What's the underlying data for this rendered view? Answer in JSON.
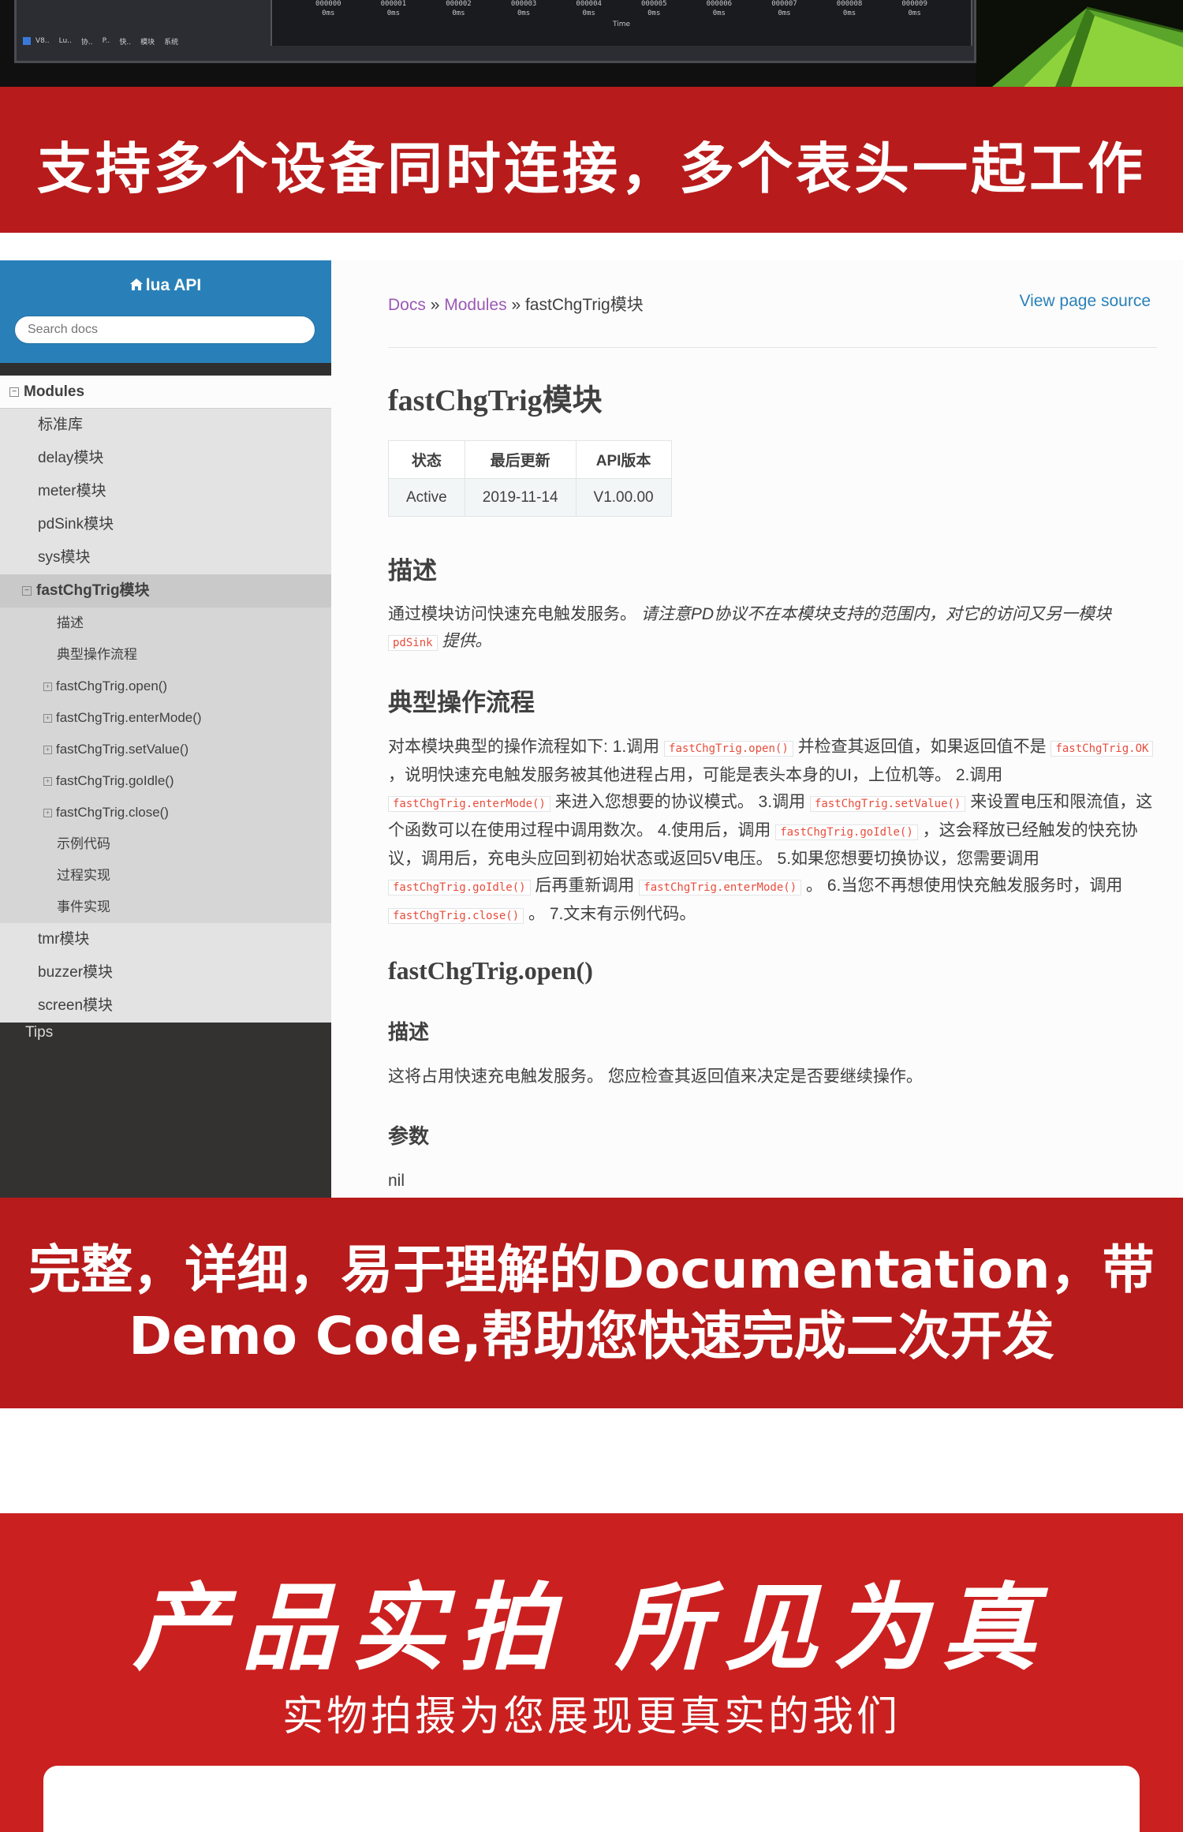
{
  "top_strip": {
    "tick_ids": [
      "000000",
      "000001",
      "000002",
      "000003",
      "000004",
      "000005",
      "000006",
      "000007",
      "000008",
      "000009"
    ],
    "tick_ms": [
      "0ms",
      "0ms",
      "0ms",
      "0ms",
      "0ms",
      "0ms",
      "0ms",
      "0ms",
      "0ms",
      "0ms"
    ],
    "time_label": "Time",
    "taskbar_items": [
      "V8..",
      "Lu..",
      "协..",
      "P..",
      "快..",
      "模块",
      "系统"
    ]
  },
  "banner1": {
    "text": "支持多个设备同时连接，多个表头一起工作"
  },
  "nav": {
    "home_label": "lua API",
    "search_placeholder": "Search docs",
    "modules_label": "Modules",
    "items": [
      "标准库",
      "delay模块",
      "meter模块",
      "pdSink模块",
      "sys模块"
    ],
    "active_item": "fastChgTrig模块",
    "sub_items": [
      "描述",
      "典型操作流程",
      "fastChgTrig.open()",
      "fastChgTrig.enterMode()",
      "fastChgTrig.setValue()",
      "fastChgTrig.goIdle()",
      "fastChgTrig.close()",
      "示例代码",
      "过程实现",
      "事件实现"
    ],
    "after_items": [
      "tmr模块",
      "buzzer模块",
      "screen模块"
    ],
    "tips_label": "Tips"
  },
  "content": {
    "breadcrumb": {
      "docs": "Docs",
      "sep1": " » ",
      "modules": "Modules",
      "sep2": " » ",
      "current": "fastChgTrig模块"
    },
    "view_source": "View page source",
    "title": "fastChgTrig模块",
    "table": {
      "headers": [
        "状态",
        "最后更新",
        "API版本"
      ],
      "row": [
        "Active",
        "2019-11-14",
        "V1.00.00"
      ]
    },
    "desc_heading": "描述",
    "desc_text": "通过模块访问快速充电触发服务。",
    "desc_note": "请注意PD协议不在本模块支持的范围内，对它的访问又另一模块",
    "desc_code": "pdSink",
    "desc_note_end": "提供。",
    "flow_heading": "典型操作流程",
    "flow": {
      "t1": "对本模块典型的操作流程如下: 1.调用",
      "c1": "fastChgTrig.open()",
      "t2": "并检查其返回值，如果返回值不是",
      "c2": "fastChgTrig.OK",
      "t3": "，说明快速充电触发服务被其他进程占用，可能是表头本身的UI，上位机等。 2.调用",
      "c3": "fastChgTrig.enterMode()",
      "t4": "来进入您想要的协议模式。 3.调用",
      "c4": "fastChgTrig.setValue()",
      "t5": "来设置电压和限流值，这个函数可以在使用过程中调用数次。 4.使用后，调用",
      "c5": "fastChgTrig.goIdle()",
      "t6": "，这会释放已经触发的快充协议，调用后，充电头应回到初始状态或返回5V电压。 5.如果您想要切换协议，您需要调用",
      "c6": "fastChgTrig.goIdle()",
      "t7": "后再重新调用",
      "c7": "fastChgTrig.enterMode()",
      "t8": "。 6.当您不再想使用快充触发服务时，调用",
      "c8": "fastChgTrig.close()",
      "t9": "。 7.文末有示例代码。"
    },
    "open_heading": "fastChgTrig.open()",
    "open_desc_heading": "描述",
    "open_desc_text": "这将占用快速充电触发服务。 您应检查其返回值来决定是否要继续操作。",
    "params_heading": "参数",
    "params_value": "nil"
  },
  "banner2": {
    "line1": "完整，详细，易于理解的Documentation，带",
    "line2": "Demo Code,帮助您快速完成二次开发"
  },
  "bottom": {
    "title": "产品实拍 所见为真",
    "subtitle": "实物拍摄为您展现更真实的我们"
  },
  "colors": {
    "banner_red": "#b81b1b",
    "bottom_red": "#cb2020",
    "nav_blue": "#2980b9",
    "link_purple": "#9b59b6",
    "code_red": "#e74c3c"
  },
  "icons": [
    "home-icon",
    "search-icon",
    "toggle-icon",
    "tent-image"
  ]
}
